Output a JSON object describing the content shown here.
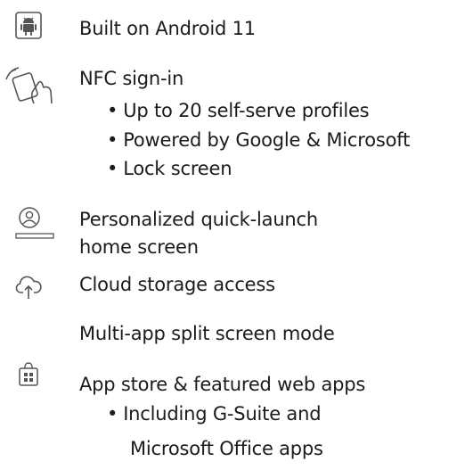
{
  "features": [
    {
      "icon": "android-icon",
      "label": "Built on Android 11"
    },
    {
      "icon": "nfc-tap-icon",
      "label": "NFC sign-in",
      "bullets": [
        "Up to 20 self-serve profiles",
        "Powered by Google & Microsoft",
        "Lock screen"
      ]
    },
    {
      "icon": "user-profile-icon",
      "label_line1": "Personalized quick-launch",
      "label_line2": "home screen"
    },
    {
      "icon": "cloud-upload-icon",
      "label": "Cloud storage access"
    },
    {
      "icon": "",
      "label": "Multi-app split screen mode"
    },
    {
      "icon": "app-store-bag-icon",
      "label": "App store & featured web apps",
      "bullets": [
        "Including G-Suite and"
      ],
      "continuation": "Microsoft Office apps"
    }
  ],
  "bullet_glyph": "•",
  "colors": {
    "text": "#1b1b1b",
    "icon_stroke": "#555555"
  }
}
